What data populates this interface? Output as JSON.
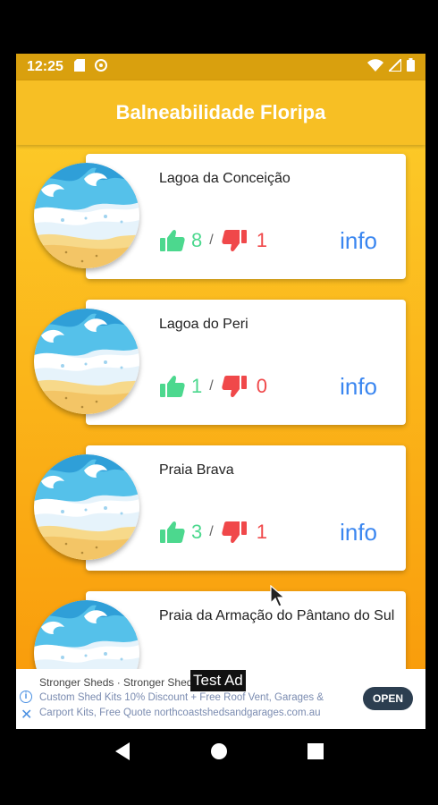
{
  "status_bar": {
    "time": "12:25"
  },
  "app_bar": {
    "title": "Balneabilidade Floripa"
  },
  "beaches": [
    {
      "name": "Lagoa da Conceição",
      "thumbs_up": "8",
      "separator": "/",
      "thumbs_down": "1",
      "info_label": "info"
    },
    {
      "name": "Lagoa do Peri",
      "thumbs_up": "1",
      "separator": "/",
      "thumbs_down": "0",
      "info_label": "info"
    },
    {
      "name": "Praia Brava",
      "thumbs_up": "3",
      "separator": "/",
      "thumbs_down": "1",
      "info_label": "info"
    },
    {
      "name": "Praia da Armação do Pântano do Sul",
      "thumbs_up": "",
      "separator": "",
      "thumbs_down": "",
      "info_label": ""
    }
  ],
  "ad": {
    "headline": "Stronger Sheds · Stronger Sheds",
    "test_label": "Test Ad",
    "text": "Custom Shed Kits 10% Discount + Free Roof Vent, Garages & Carport Kits, Free Quote northcoastshedsandgarages.com.au",
    "open_label": "OPEN"
  },
  "colors": {
    "status_bar": "#d9a00e",
    "app_bar": "#f7bf24",
    "thumbs_up": "#4cd88e",
    "thumbs_down": "#f0484a",
    "info_link": "#3a86f0"
  },
  "icons": [
    "sd-card-icon",
    "sync-icon",
    "wifi-icon",
    "cell-signal-icon",
    "battery-icon",
    "thumbs-up-icon",
    "thumbs-down-icon",
    "beach-wave-icon",
    "ad-info-icon",
    "ad-close-icon",
    "back-icon",
    "home-icon",
    "recents-icon",
    "cursor-icon"
  ]
}
